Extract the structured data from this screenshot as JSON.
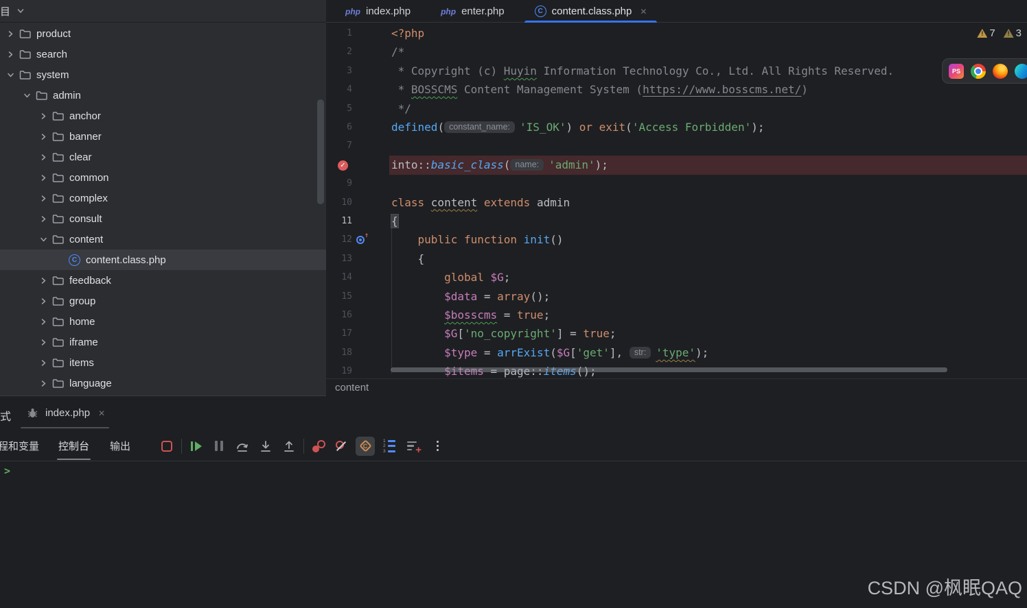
{
  "watermark": "CSDN @枫眠QAQ",
  "project_panel": {
    "header_title": "目",
    "tree": [
      {
        "label": "product",
        "level": 0,
        "chevron": "right",
        "icon": "folder"
      },
      {
        "label": "search",
        "level": 0,
        "chevron": "right",
        "icon": "folder"
      },
      {
        "label": "system",
        "level": 0,
        "chevron": "down",
        "icon": "folder"
      },
      {
        "label": "admin",
        "level": 1,
        "chevron": "down",
        "icon": "folder"
      },
      {
        "label": "anchor",
        "level": 2,
        "chevron": "right",
        "icon": "folder"
      },
      {
        "label": "banner",
        "level": 2,
        "chevron": "right",
        "icon": "folder"
      },
      {
        "label": "clear",
        "level": 2,
        "chevron": "right",
        "icon": "folder"
      },
      {
        "label": "common",
        "level": 2,
        "chevron": "right",
        "icon": "folder"
      },
      {
        "label": "complex",
        "level": 2,
        "chevron": "right",
        "icon": "folder"
      },
      {
        "label": "consult",
        "level": 2,
        "chevron": "right",
        "icon": "folder"
      },
      {
        "label": "content",
        "level": 2,
        "chevron": "down",
        "icon": "folder"
      },
      {
        "label": "content.class.php",
        "level": 3,
        "chevron": "none",
        "icon": "class",
        "selected": true
      },
      {
        "label": "feedback",
        "level": 2,
        "chevron": "right",
        "icon": "folder"
      },
      {
        "label": "group",
        "level": 2,
        "chevron": "right",
        "icon": "folder"
      },
      {
        "label": "home",
        "level": 2,
        "chevron": "right",
        "icon": "folder"
      },
      {
        "label": "iframe",
        "level": 2,
        "chevron": "right",
        "icon": "folder"
      },
      {
        "label": "items",
        "level": 2,
        "chevron": "right",
        "icon": "folder"
      },
      {
        "label": "language",
        "level": 2,
        "chevron": "right",
        "icon": "folder"
      }
    ]
  },
  "editor": {
    "tabs": [
      {
        "label": "index.php",
        "icon": "php",
        "active": false,
        "closable": false
      },
      {
        "label": "enter.php",
        "icon": "php",
        "active": false,
        "closable": false
      },
      {
        "label": "content.class.php",
        "icon": "class",
        "active": true,
        "closable": true,
        "close_glyph": "✕"
      }
    ],
    "inspections": {
      "warnings": "7",
      "weak_warnings": "3"
    },
    "browser_toolbar": [
      "phpstorm",
      "chrome",
      "firefox",
      "edge"
    ],
    "breadcrumb": "content",
    "code": {
      "language": "php",
      "lines": [
        {
          "n": 1,
          "tokens": [
            {
              "t": "<?php",
              "c": "kw"
            }
          ]
        },
        {
          "n": 2,
          "tokens": [
            {
              "t": "/*",
              "c": "cmt"
            }
          ]
        },
        {
          "n": 3,
          "tokens": [
            {
              "t": " * Copyright (c) ",
              "c": "cmt"
            },
            {
              "t": "Huyin",
              "c": "cmt",
              "d": "sqg"
            },
            {
              "t": " Information Technology Co., Ltd. All Rights Reserved.",
              "c": "cmt"
            }
          ]
        },
        {
          "n": 4,
          "tokens": [
            {
              "t": " * ",
              "c": "cmt"
            },
            {
              "t": "BOSSCMS",
              "c": "cmt",
              "d": "sqg"
            },
            {
              "t": " Content Management System (",
              "c": "cmt"
            },
            {
              "t": "https://www.bosscms.net/",
              "c": "cmt",
              "d": "url"
            },
            {
              "t": ")",
              "c": "cmt"
            }
          ]
        },
        {
          "n": 5,
          "tokens": [
            {
              "t": " */",
              "c": "cmt"
            }
          ]
        },
        {
          "n": 6,
          "tokens": [
            {
              "t": "defined",
              "c": "fn"
            },
            {
              "t": "(",
              "c": "pln"
            },
            {
              "h": "constant_name:"
            },
            {
              "t": "'IS_OK'",
              "c": "str"
            },
            {
              "t": ") ",
              "c": "pln"
            },
            {
              "t": "or",
              "c": "kw"
            },
            {
              "t": " ",
              "c": "pln"
            },
            {
              "t": "exit",
              "c": "kw"
            },
            {
              "t": "(",
              "c": "pln"
            },
            {
              "t": "'Access Forbidden'",
              "c": "str"
            },
            {
              "t": ");",
              "c": "pln"
            }
          ]
        },
        {
          "n": 7,
          "tokens": []
        },
        {
          "n": 8,
          "breakpoint": true,
          "highlight": true,
          "tokens": [
            {
              "t": "into",
              "c": "pln"
            },
            {
              "t": "::",
              "c": "pln"
            },
            {
              "t": "basic_class",
              "c": "fni"
            },
            {
              "t": "(",
              "c": "pln"
            },
            {
              "h": "name:"
            },
            {
              "t": "'admin'",
              "c": "str"
            },
            {
              "t": ");",
              "c": "pln"
            }
          ]
        },
        {
          "n": 9,
          "tokens": []
        },
        {
          "n": 10,
          "tokens": [
            {
              "t": "class ",
              "c": "kw"
            },
            {
              "t": "content",
              "c": "pln",
              "d": "sqy"
            },
            {
              "t": " ",
              "c": "pln"
            },
            {
              "t": "extends",
              "c": "kw"
            },
            {
              "t": " admin",
              "c": "pln"
            }
          ]
        },
        {
          "n": 11,
          "caret_line": true,
          "tokens": [
            {
              "t": "{",
              "c": "pln",
              "box": true
            }
          ]
        },
        {
          "n": 12,
          "override_marker": true,
          "tokens": [
            {
              "t": "    ",
              "c": "pln"
            },
            {
              "t": "public",
              "c": "kw"
            },
            {
              "t": " ",
              "c": "pln"
            },
            {
              "t": "function",
              "c": "kw"
            },
            {
              "t": " ",
              "c": "pln"
            },
            {
              "t": "init",
              "c": "fn"
            },
            {
              "t": "()",
              "c": "pln"
            }
          ]
        },
        {
          "n": 13,
          "tokens": [
            {
              "t": "    {",
              "c": "pln"
            }
          ]
        },
        {
          "n": 14,
          "tokens": [
            {
              "t": "        ",
              "c": "pln"
            },
            {
              "t": "global",
              "c": "kw"
            },
            {
              "t": " ",
              "c": "pln"
            },
            {
              "t": "$G",
              "c": "var"
            },
            {
              "t": ";",
              "c": "pln"
            }
          ]
        },
        {
          "n": 15,
          "tokens": [
            {
              "t": "        ",
              "c": "pln"
            },
            {
              "t": "$data",
              "c": "var"
            },
            {
              "t": " = ",
              "c": "pln"
            },
            {
              "t": "array",
              "c": "kw"
            },
            {
              "t": "();",
              "c": "pln"
            }
          ]
        },
        {
          "n": 16,
          "tokens": [
            {
              "t": "        ",
              "c": "pln"
            },
            {
              "t": "$bosscms",
              "c": "var",
              "d": "sqg"
            },
            {
              "t": " = ",
              "c": "pln"
            },
            {
              "t": "true",
              "c": "kw"
            },
            {
              "t": ";",
              "c": "pln"
            }
          ]
        },
        {
          "n": 17,
          "tokens": [
            {
              "t": "        ",
              "c": "pln"
            },
            {
              "t": "$G",
              "c": "var"
            },
            {
              "t": "[",
              "c": "pln"
            },
            {
              "t": "'no_copyright'",
              "c": "str"
            },
            {
              "t": "] = ",
              "c": "pln"
            },
            {
              "t": "true",
              "c": "kw"
            },
            {
              "t": ";",
              "c": "pln"
            }
          ]
        },
        {
          "n": 18,
          "tokens": [
            {
              "t": "        ",
              "c": "pln"
            },
            {
              "t": "$type",
              "c": "var"
            },
            {
              "t": " = ",
              "c": "pln"
            },
            {
              "t": "arrExist",
              "c": "fn"
            },
            {
              "t": "(",
              "c": "pln"
            },
            {
              "t": "$G",
              "c": "var"
            },
            {
              "t": "[",
              "c": "pln"
            },
            {
              "t": "'get'",
              "c": "str"
            },
            {
              "t": "], ",
              "c": "pln"
            },
            {
              "h": "str:"
            },
            {
              "t": "'type'",
              "c": "str",
              "d": "sqy"
            },
            {
              "t": ");",
              "c": "pln"
            }
          ]
        },
        {
          "n": 19,
          "tokens": [
            {
              "t": "        ",
              "c": "pln"
            },
            {
              "t": "$items",
              "c": "var"
            },
            {
              "t": " = ",
              "c": "pln"
            },
            {
              "t": "page",
              "c": "pln"
            },
            {
              "t": "::",
              "c": "pln"
            },
            {
              "t": "items",
              "c": "fni"
            },
            {
              "t": "();",
              "c": "pln"
            }
          ]
        }
      ]
    }
  },
  "debug_panel": {
    "window_title_clipped": "式",
    "session_tab": {
      "label": "index.php",
      "icon": "bug",
      "close_glyph": "✕"
    },
    "view_tabs": [
      {
        "label": "程和变量",
        "active": false,
        "clipped": true
      },
      {
        "label": "控制台",
        "active": true
      },
      {
        "label": "输出",
        "active": false
      }
    ],
    "toolbar_icons": [
      "stop",
      "resume",
      "pause",
      "step-over",
      "step-into",
      "step-out",
      "view-breakpoints",
      "mute-breakpoints",
      "php-console",
      "ordered-list",
      "add-to-watches",
      "more"
    ],
    "console_prompt": ">"
  },
  "colors": {
    "panel_bg": "#2b2d30",
    "editor_bg": "#1e1f22",
    "accent_blue": "#3574f0",
    "selection_row": "#393b40",
    "breakpoint_red": "#db5c5c",
    "breakpoint_line_bg": "#45292c",
    "keyword": "#cf8e6d",
    "string": "#6aab73",
    "variable": "#c77dbb",
    "function_call": "#56a8f5",
    "comment": "#848890"
  }
}
